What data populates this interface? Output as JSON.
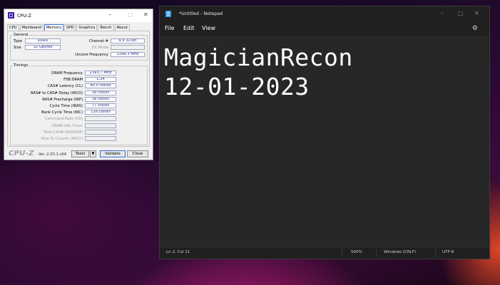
{
  "cpuz": {
    "title": "CPU-Z",
    "min": "–",
    "max": "□",
    "close": "✕",
    "tabs": [
      "CPU",
      "Mainboard",
      "Memory",
      "SPD",
      "Graphics",
      "Bench",
      "About"
    ],
    "active_tab": "Memory",
    "general": {
      "label": "General",
      "type_label": "Type",
      "type_value": "DDR5",
      "size_label": "Size",
      "size_value": "32 GBytes",
      "channel_label": "Channel #",
      "channel_value": "4 x 32-bit",
      "dc_mode_label": "DC Mode",
      "dc_mode_value": "",
      "uncore_label": "Uncore Frequency",
      "uncore_value": "1196.3 MHz"
    },
    "timings": {
      "label": "Timings",
      "rows": [
        {
          "label": "DRAM Frequency",
          "value": "2393.7 MHz",
          "disabled": false
        },
        {
          "label": "FSB:DRAM",
          "value": "1:24",
          "disabled": false
        },
        {
          "label": "CAS# Latency (CL)",
          "value": "40.0 clocks",
          "disabled": false
        },
        {
          "label": "RAS# to CAS# Delay (tRCD)",
          "value": "39 clocks",
          "disabled": false
        },
        {
          "label": "RAS# Precharge (tRP)",
          "value": "39 clocks",
          "disabled": false
        },
        {
          "label": "Cycle Time (tRAS)",
          "value": "77 clocks",
          "disabled": false
        },
        {
          "label": "Bank Cycle Time (tRC)",
          "value": "116 clocks",
          "disabled": false
        },
        {
          "label": "Command Rate (CR)",
          "value": "",
          "disabled": true
        },
        {
          "label": "DRAM Idle Timer",
          "value": "",
          "disabled": true
        },
        {
          "label": "Total CAS# (tRDRAM)",
          "value": "",
          "disabled": true
        },
        {
          "label": "Row To Column (tRCD)",
          "value": "",
          "disabled": true
        }
      ]
    },
    "footer": {
      "brand": "CPU-Z",
      "version": "Ver. 2.03.1.x64",
      "tools": "Tools",
      "tools_arrow": "▼",
      "validate": "Validate",
      "close": "Close"
    }
  },
  "notepad": {
    "title": "*Untitled - Notepad",
    "min": "–",
    "max": "□",
    "close": "✕",
    "menu": [
      "File",
      "Edit",
      "View"
    ],
    "settings_icon": "gear-icon",
    "settings_glyph": "⚙",
    "content_lines": [
      "MagicianRecon",
      "12-01-2023"
    ],
    "status": {
      "position": "Ln 2, Col 11",
      "zoom": "500%",
      "line_ending": "Windows (CRLF)",
      "encoding": "UTF-8"
    }
  }
}
